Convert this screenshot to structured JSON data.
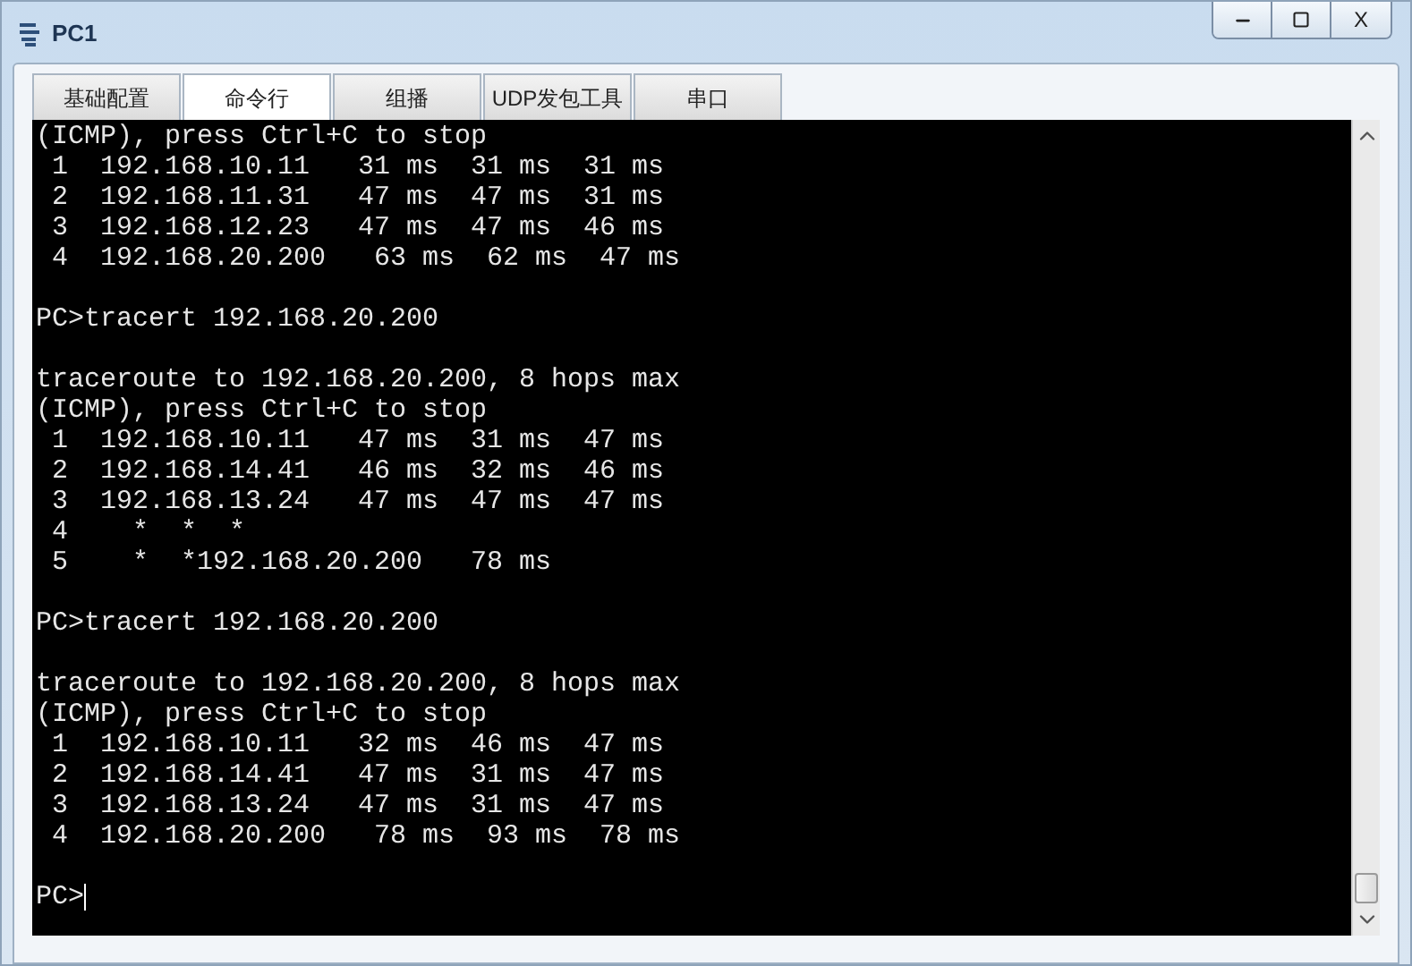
{
  "window": {
    "title": "PC1",
    "close_label": "X"
  },
  "tabs": [
    {
      "label": "基础配置",
      "selected": false
    },
    {
      "label": "命令行",
      "selected": true
    },
    {
      "label": "组播",
      "selected": false
    },
    {
      "label": "UDP发包工具",
      "selected": false
    },
    {
      "label": "串口",
      "selected": false
    }
  ],
  "terminal": {
    "lines": [
      {
        "kind": "text",
        "text": "(ICMP), press Ctrl+C to stop"
      },
      {
        "kind": "text",
        "text": " 1  192.168.10.11   31 ms  31 ms  31 ms"
      },
      {
        "kind": "text",
        "text": " 2  192.168.11.31   47 ms  47 ms  31 ms"
      },
      {
        "kind": "text",
        "text": " 3  192.168.12.23   47 ms  47 ms  46 ms"
      },
      {
        "kind": "text",
        "text": " 4  192.168.20.200   63 ms  62 ms  47 ms"
      },
      {
        "kind": "blank"
      },
      {
        "kind": "text",
        "text": "PC>tracert 192.168.20.200"
      },
      {
        "kind": "blank"
      },
      {
        "kind": "text",
        "text": "traceroute to 192.168.20.200, 8 hops max"
      },
      {
        "kind": "text",
        "text": "(ICMP), press Ctrl+C to stop"
      },
      {
        "kind": "text",
        "text": " 1  192.168.10.11   47 ms  31 ms  47 ms"
      },
      {
        "kind": "text",
        "text": " 2  192.168.14.41   46 ms  32 ms  46 ms"
      },
      {
        "kind": "text",
        "text": " 3  192.168.13.24   47 ms  47 ms  47 ms"
      },
      {
        "kind": "text",
        "text": " 4    *  *  *"
      },
      {
        "kind": "text",
        "text": " 5    *  *192.168.20.200   78 ms"
      },
      {
        "kind": "blank"
      },
      {
        "kind": "text",
        "text": "PC>tracert 192.168.20.200"
      },
      {
        "kind": "blank"
      },
      {
        "kind": "text",
        "text": "traceroute to 192.168.20.200, 8 hops max"
      },
      {
        "kind": "text",
        "text": "(ICMP), press Ctrl+C to stop"
      },
      {
        "kind": "text",
        "text": " 1  192.168.10.11   32 ms  46 ms  47 ms"
      },
      {
        "kind": "text",
        "text": " 2  192.168.14.41   47 ms  31 ms  47 ms"
      },
      {
        "kind": "text",
        "text": " 3  192.168.13.24   47 ms  31 ms  47 ms"
      },
      {
        "kind": "text",
        "text": " 4  192.168.20.200   78 ms  93 ms  78 ms"
      },
      {
        "kind": "blank"
      },
      {
        "kind": "prompt",
        "text": "PC>",
        "cursor": true
      }
    ]
  }
}
